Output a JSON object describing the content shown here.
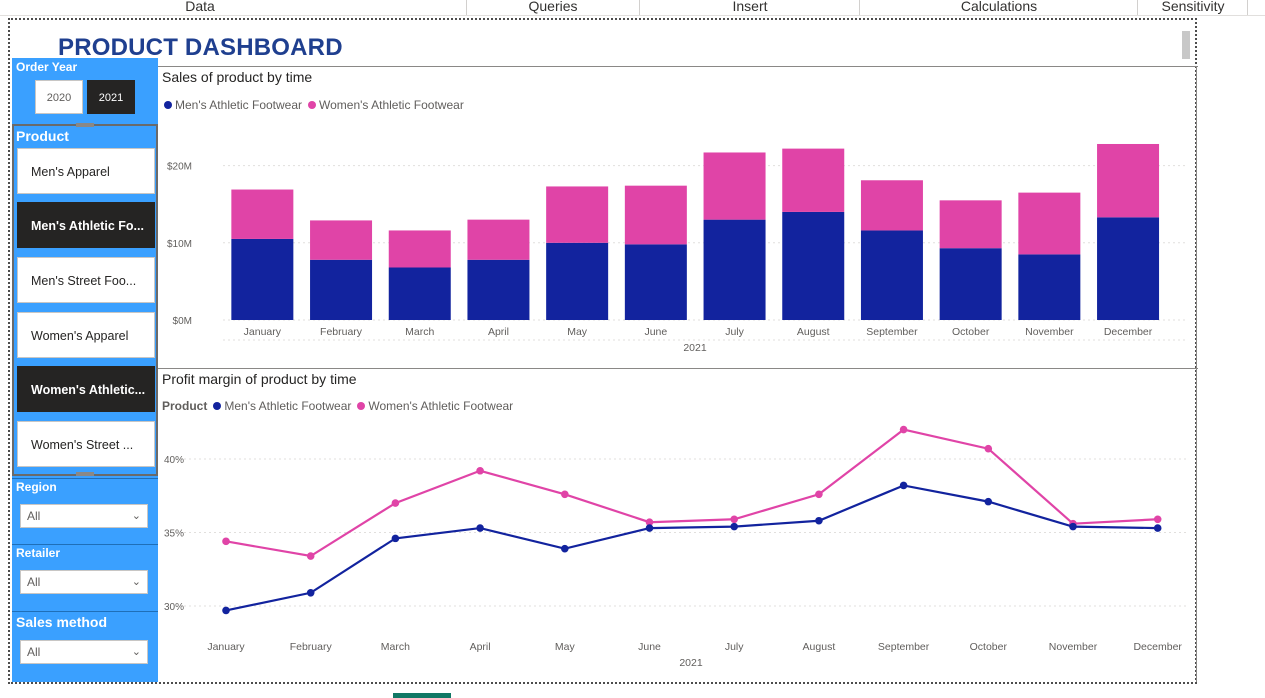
{
  "ribbon": {
    "tabs": [
      "Data",
      "Queries",
      "Insert",
      "Calculations",
      "Sensitivity"
    ]
  },
  "dashboard": {
    "title": "PRODUCT DASHBOARD"
  },
  "slicers": {
    "order_year": {
      "label": "Order Year",
      "options": [
        "2020",
        "2021"
      ],
      "selected": "2021"
    },
    "product": {
      "label": "Product",
      "items": [
        {
          "label": "Men's Apparel",
          "selected": false
        },
        {
          "label": "Men's Athletic Fo...",
          "selected": true
        },
        {
          "label": "Men's Street Foo...",
          "selected": false
        },
        {
          "label": "Women's Apparel",
          "selected": false
        },
        {
          "label": "Women's Athletic...",
          "selected": true
        },
        {
          "label": "Women's Street ...",
          "selected": false
        }
      ]
    },
    "region": {
      "label": "Region",
      "value": "All"
    },
    "retailer": {
      "label": "Retailer",
      "value": "All"
    },
    "sales_method": {
      "label": "Sales method",
      "value": "All"
    }
  },
  "colors": {
    "mens": "#12239e",
    "womens": "#e044a7",
    "slicer_bg": "#3aa0ff",
    "title": "#1f3f8f"
  },
  "chart_data": [
    {
      "type": "bar",
      "stacked": true,
      "title": "Sales of product by time",
      "categories": [
        "January",
        "February",
        "March",
        "April",
        "May",
        "June",
        "July",
        "August",
        "September",
        "October",
        "November",
        "December"
      ],
      "x_group_label": "2021",
      "series": [
        {
          "name": "Men's Athletic Footwear",
          "color": "#12239e",
          "values": [
            10.5,
            7.8,
            6.8,
            7.8,
            10.0,
            9.8,
            13.0,
            14.0,
            11.6,
            9.3,
            8.5,
            13.3
          ]
        },
        {
          "name": "Women's Athletic Footwear",
          "color": "#e044a7",
          "values": [
            6.4,
            5.1,
            4.8,
            5.2,
            7.3,
            7.6,
            8.7,
            8.2,
            6.5,
            6.2,
            8.0,
            9.5
          ]
        }
      ],
      "y_ticks": [
        "$0M",
        "$10M",
        "$20M"
      ],
      "ylim": [
        0,
        24
      ],
      "legend": "top-left"
    },
    {
      "type": "line",
      "title": "Profit margin of product by time",
      "legend_title": "Product",
      "categories": [
        "January",
        "February",
        "March",
        "April",
        "May",
        "June",
        "July",
        "August",
        "September",
        "October",
        "November",
        "December"
      ],
      "x_group_label": "2021",
      "series": [
        {
          "name": "Men's Athletic Footwear",
          "color": "#12239e",
          "values": [
            29.7,
            30.9,
            34.6,
            35.3,
            33.9,
            35.3,
            35.4,
            35.8,
            38.2,
            37.1,
            35.4,
            35.3
          ]
        },
        {
          "name": "Women's Athletic Footwear",
          "color": "#e044a7",
          "values": [
            34.4,
            33.4,
            37.0,
            39.2,
            37.6,
            35.7,
            35.9,
            37.6,
            42.0,
            40.7,
            35.6,
            35.9
          ]
        }
      ],
      "y_ticks": [
        "30%",
        "35%",
        "40%"
      ],
      "ylim": [
        29.65,
        43.5
      ],
      "legend": "top-left"
    }
  ]
}
